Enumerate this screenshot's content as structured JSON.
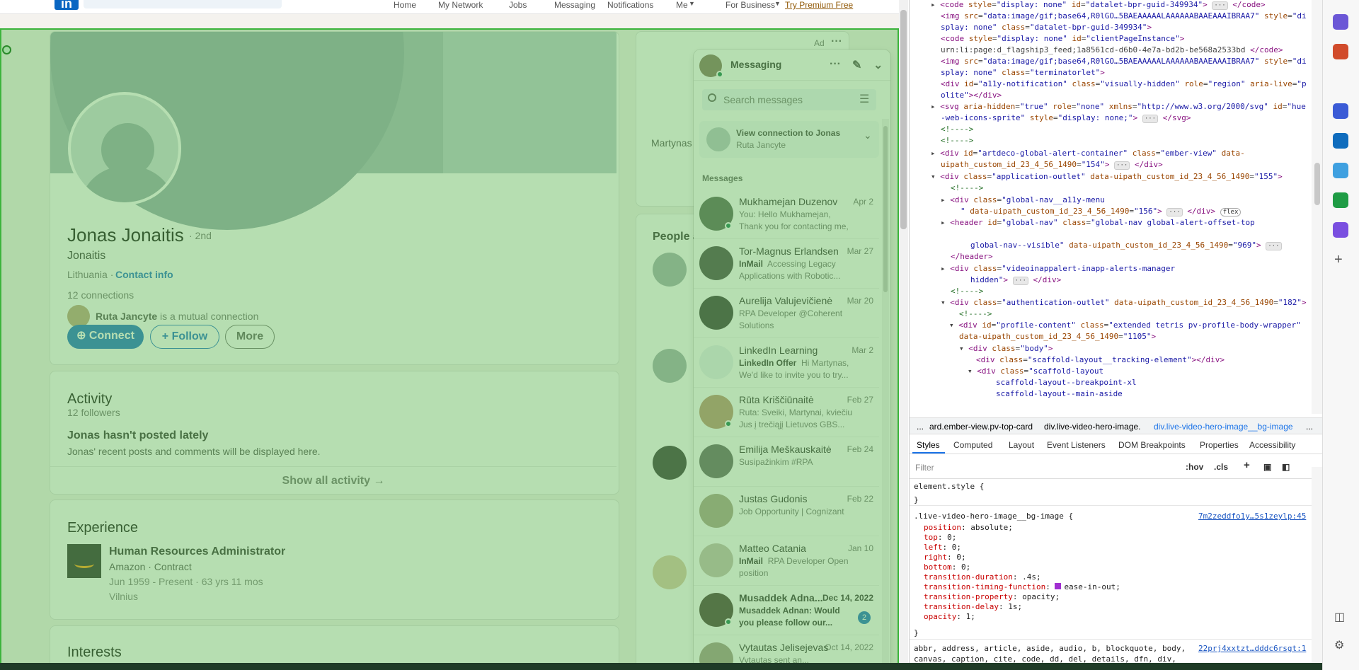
{
  "nav": {
    "items": [
      "Home",
      "My Network",
      "Jobs",
      "Messaging",
      "Notifications",
      "Me",
      "For Business",
      "Try Premium Free"
    ],
    "logo": "in"
  },
  "profile": {
    "name": "Jonas Jonaitis",
    "degree": "· 2nd",
    "headline": "Jonaitis",
    "location": "Lithuania ·",
    "contact": "Contact info",
    "connections": "12 connections",
    "mutual_name": "Ruta Jancyte",
    "mutual_suffix": " is a mutual connection",
    "connect": "Connect",
    "follow": "Follow",
    "more": "More"
  },
  "activity": {
    "title": "Activity",
    "followers": "12 followers",
    "empty_title": "Jonas hasn't posted lately",
    "empty_sub": "Jonas' recent posts and comments will be displayed here.",
    "show_all": "Show all activity →"
  },
  "experience": {
    "title": "Experience",
    "role": "Human Resources Administrator",
    "company": "Amazon · Contract",
    "dates": "Jun 1959 - Present · 63 yrs 11 mos",
    "location": "Vilnius"
  },
  "interests": {
    "title": "Interests"
  },
  "aside": {
    "ad": "Ad",
    "ad_name": "Martynas",
    "people": "People a"
  },
  "messaging": {
    "title": "Messaging",
    "search_placeholder": "Search messages",
    "view_connection": "View connection to Jonas",
    "view_connection_sub": "Ruta Jancyte",
    "section": "Messages",
    "threads": [
      {
        "name": "Mukhamejan Duzenov",
        "date": "Apr 2",
        "snippet": "You: Hello Mukhamejan, Thank you for contacting me, but...",
        "tag": "",
        "online": true,
        "bold": false
      },
      {
        "name": "Tor-Magnus Erlandsen",
        "date": "Mar 27",
        "tag": "InMail",
        "snippet": "Accessing Legacy Applications with Robotic...",
        "online": false,
        "bold": false
      },
      {
        "name": "Aurelija Valujevičienė",
        "date": "Mar 20",
        "tag": "",
        "snippet": "RPA Developer @Coherent Solutions",
        "online": false,
        "bold": false
      },
      {
        "name": "LinkedIn Learning",
        "date": "Mar 2",
        "tag": "LinkedIn Offer",
        "snippet": "Hi Martynas, We'd like to invite you to try...",
        "online": false,
        "bold": false
      },
      {
        "name": "Rūta Kriščiūnaitė",
        "date": "Feb 27",
        "tag": "",
        "snippet": "Ruta: Sveiki, Martynai,  kviečiu Jus į trečiąjį Lietuvos GBS...",
        "online": true,
        "bold": false
      },
      {
        "name": "Emilija Meškauskaitė",
        "date": "Feb 24",
        "tag": "",
        "snippet": "Susipažinkim #RPA",
        "online": false,
        "bold": false
      },
      {
        "name": "Justas Gudonis",
        "date": "Feb 22",
        "tag": "",
        "snippet": "Job Opportunity | Cognizant",
        "online": false,
        "bold": false
      },
      {
        "name": "Matteo Catania",
        "date": "Jan 10",
        "tag": "InMail",
        "snippet": "RPA Developer Open position",
        "online": false,
        "bold": false
      },
      {
        "name": "Musaddek Adna...",
        "date": "Dec 14, 2022",
        "tag": "",
        "snippet": "Musaddek Adnan: Would you please follow our...",
        "online": true,
        "bold": true,
        "badge": "2"
      },
      {
        "name": "Vytautas Jelisejevas",
        "date": "Oct 14, 2022",
        "tag": "",
        "snippet": "Vytautas sent an...",
        "online": false,
        "bold": false
      }
    ]
  },
  "devtools": {
    "crumbs": [
      "...",
      "ard.ember-view.pv-top-card",
      "div.live-video-hero-image.",
      "div.live-video-hero-image__bg-image",
      "..."
    ],
    "tabs": [
      "Styles",
      "Computed",
      "Layout",
      "Event Listeners",
      "DOM Breakpoints",
      "Properties",
      "Accessibility"
    ],
    "filter_placeholder": "Filter",
    "hov": ":hov",
    "cls": ".cls",
    "element_style": "element.style {",
    "close": "}",
    "selector": ".live-video-hero-image__bg-image {",
    "source1": "7m2zeddfo1y…5s1zeylp:45",
    "decls": [
      [
        "position",
        "absolute;"
      ],
      [
        "top",
        "0;"
      ],
      [
        "left",
        "0;"
      ],
      [
        "right",
        "0;"
      ],
      [
        "bottom",
        "0;"
      ],
      [
        "transition-duration",
        ".4s;"
      ],
      [
        "transition-timing-function",
        "ease-in-out;"
      ],
      [
        "transition-property",
        "opacity;"
      ],
      [
        "transition-delay",
        "1s;"
      ],
      [
        "opacity",
        "1;"
      ]
    ],
    "ua_selectors": "abbr, address, article, aside, audio, b, blockquote, body,",
    "ua_selectors2": "canvas, caption, cite, code, dd, del, details, dfn, div,",
    "source2": "22prj4xxtzt…dddc6rsgt:1"
  },
  "colors": {
    "brand": "#0a66c2",
    "overlay": "#6ebe64",
    "online": "#057642"
  }
}
